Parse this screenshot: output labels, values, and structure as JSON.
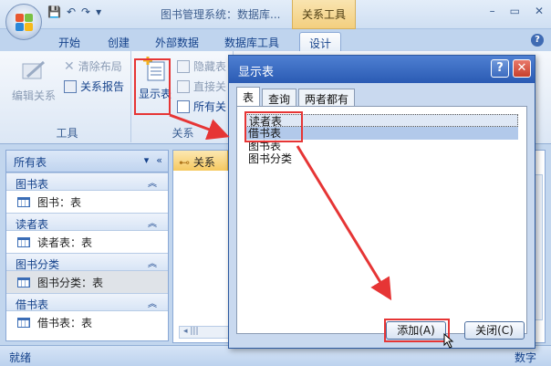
{
  "window": {
    "title": "图书管理系统：数据库...",
    "context_tab_title": "关系工具",
    "controls": [
      "–",
      "▭",
      "✕"
    ]
  },
  "ribbon_tabs": [
    "开始",
    "创建",
    "外部数据",
    "数据库工具",
    "设计"
  ],
  "ribbon": {
    "tools_group": {
      "label": "工具",
      "edit_relations": "编辑关系",
      "clear_layout": "清除布局",
      "relation_report": "关系报告"
    },
    "relations_group": {
      "label": "关系",
      "show_table": "显示表",
      "hide_table": "隐藏表",
      "direct_relations": "直接关",
      "all_relations": "所有关"
    }
  },
  "nav": {
    "header": "所有表",
    "groups": [
      {
        "name": "图书表",
        "item": "图书：表"
      },
      {
        "name": "读者表",
        "item": "读者表：表"
      },
      {
        "name": "图书分类",
        "item": "图书分类：表"
      },
      {
        "name": "借书表",
        "item": "借书表：表"
      }
    ]
  },
  "doc_tab": "关系",
  "status": {
    "left": "就绪",
    "right": "数字"
  },
  "dialog": {
    "title": "显示表",
    "tabs": [
      "表",
      "查询",
      "两者都有"
    ],
    "list": [
      "读者表",
      "借书表",
      "图书表",
      "图书分类"
    ],
    "add_button": "添加(A)",
    "close_button": "关闭(C)"
  },
  "colors": {
    "annotation_red": "#e63535",
    "accent_blue": "#2b5bb4"
  }
}
